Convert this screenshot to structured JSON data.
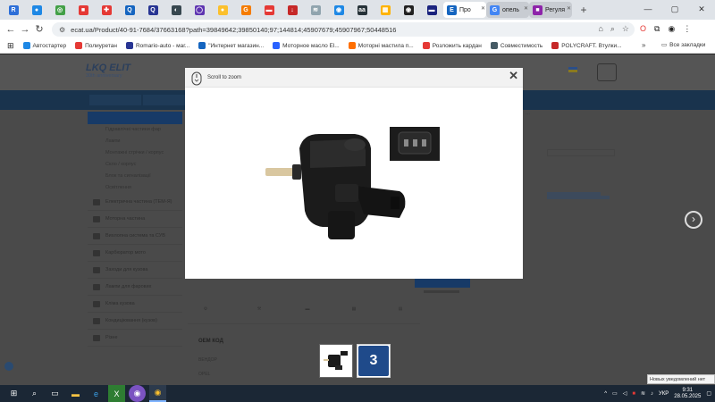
{
  "browser": {
    "tabs": [
      {
        "icon": "R",
        "color": "#2d6fd8",
        "label": ""
      },
      {
        "icon": "●",
        "color": "#1e88e5",
        "label": ""
      },
      {
        "icon": "◎",
        "color": "#43a047",
        "label": ""
      },
      {
        "icon": "■",
        "color": "#e53935",
        "label": ""
      },
      {
        "icon": "✚",
        "color": "#e53935",
        "label": ""
      },
      {
        "icon": "Q",
        "color": "#1565c0",
        "label": ""
      },
      {
        "icon": "Q",
        "color": "#283593",
        "label": ""
      },
      {
        "icon": "◐",
        "color": "#37474f",
        "label": ""
      },
      {
        "icon": "◯",
        "color": "#5e35b1",
        "label": ""
      },
      {
        "icon": "●",
        "color": "#fbc02d",
        "label": ""
      },
      {
        "icon": "G",
        "color": "#f57c00",
        "label": ""
      },
      {
        "icon": "▬",
        "color": "#e53935",
        "label": ""
      },
      {
        "icon": "↓",
        "color": "#c62828",
        "label": ""
      },
      {
        "icon": "≋",
        "color": "#90a4ae",
        "label": ""
      },
      {
        "icon": "◉",
        "color": "#1e88e5",
        "label": ""
      },
      {
        "icon": "aa",
        "color": "#263238",
        "label": ""
      },
      {
        "icon": "▦",
        "color": "#ffb300",
        "label": ""
      },
      {
        "icon": "◉",
        "color": "#212121",
        "label": ""
      },
      {
        "icon": "▬",
        "color": "#1a237e",
        "label": ""
      },
      {
        "icon": "E",
        "color": "#1565c0",
        "label": "Про"
      },
      {
        "icon": "G",
        "color": "#4285f4",
        "label": "опель"
      },
      {
        "icon": "■",
        "color": "#8e24aa",
        "label": "Регуля"
      }
    ],
    "new_tab": "+",
    "url": "ecat.ua/Product/40-91-7684/37663168?path=39849642;39850140;97;144814;45907679;45907967;50448516",
    "bookmarks": [
      {
        "label": "Автостартер",
        "color": "#1e88e5"
      },
      {
        "label": "Полиуретан",
        "color": "#e53935"
      },
      {
        "label": "Romario-auto - маг...",
        "color": "#283593"
      },
      {
        "label": "\"Интернет магазин...",
        "color": "#1565c0"
      },
      {
        "label": "Моторное масло El...",
        "color": "#2962ff"
      },
      {
        "label": "Моторні мастила п...",
        "color": "#ff6f00"
      },
      {
        "label": "Розложить кардан",
        "color": "#e53935"
      },
      {
        "label": "Совместимость",
        "color": "#455a64"
      },
      {
        "label": "POLYCRAFT. Втулки...",
        "color": "#c62828"
      }
    ],
    "bookmarks_more": "»",
    "all_bookmarks": "Все закладки"
  },
  "site": {
    "logo": "LKQ ELIT",
    "logo_sub": "30th anniversary",
    "sidebar_items": [
      "Гідравлічні частини фар",
      "Лампи",
      "Монтажні стрічки / корпус",
      "Скло / корпус",
      "Блок та сигналізації",
      "Освітлення"
    ],
    "sidebar_cats": [
      "Електрична частина (TEM-Я)",
      "Моторна частина",
      "Вихлопна система та СУВ",
      "Карбюратор мото",
      "Заходи для кузова",
      "Лампи для фарових",
      "Кліма кузова",
      "Кондиціювання (кузов)",
      "Різне"
    ],
    "oem_title": "OEM КОД",
    "oem_rows": [
      "ВЕНДОР",
      "ОPEL"
    ]
  },
  "modal": {
    "zoom_hint": "Scroll to zoom",
    "close": "✕"
  },
  "taskbar": {
    "lang": "УКР",
    "time": "9:31",
    "date": "28.05.2025",
    "notification": "Новых уведомлений нет"
  }
}
